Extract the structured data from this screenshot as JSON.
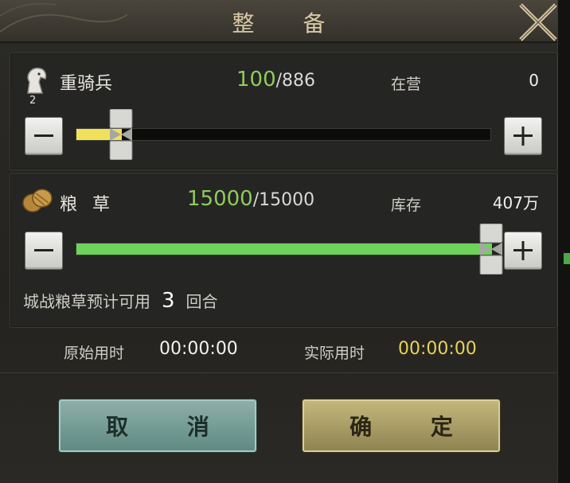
{
  "dialog": {
    "title": "整 备"
  },
  "cavalry": {
    "name": "重骑兵",
    "level": "2",
    "current": "100",
    "max": "/886",
    "side_label": "在营",
    "side_value": "0",
    "slider_fraction": 0.11,
    "fill_color": "#f1e15a"
  },
  "grain": {
    "name": "粮 草",
    "current": "15000",
    "max": "/15000",
    "side_label": "库存",
    "side_value": "407万",
    "slider_fraction": 1.0,
    "fill_color": "#6ed35a",
    "info_prefix": "城战粮草预计可用",
    "info_rounds": "3",
    "info_suffix": "回合"
  },
  "time": {
    "original_label": "原始用时",
    "original_value": "00:00:00",
    "actual_label": "实际用时",
    "actual_value": "00:00:00",
    "original_color": "#f2f2f2",
    "actual_color": "#e8d259"
  },
  "buttons": {
    "cancel": "取 消",
    "confirm": "确 定"
  },
  "icons": {
    "close": "close-x-icon",
    "cavalry": "horse-head-icon",
    "grain": "grain-bundle-icon",
    "minus": "minus-icon",
    "plus": "plus-icon"
  },
  "colors": {
    "accent_green": "#8fcb5c",
    "title": "#d9c9a4"
  }
}
